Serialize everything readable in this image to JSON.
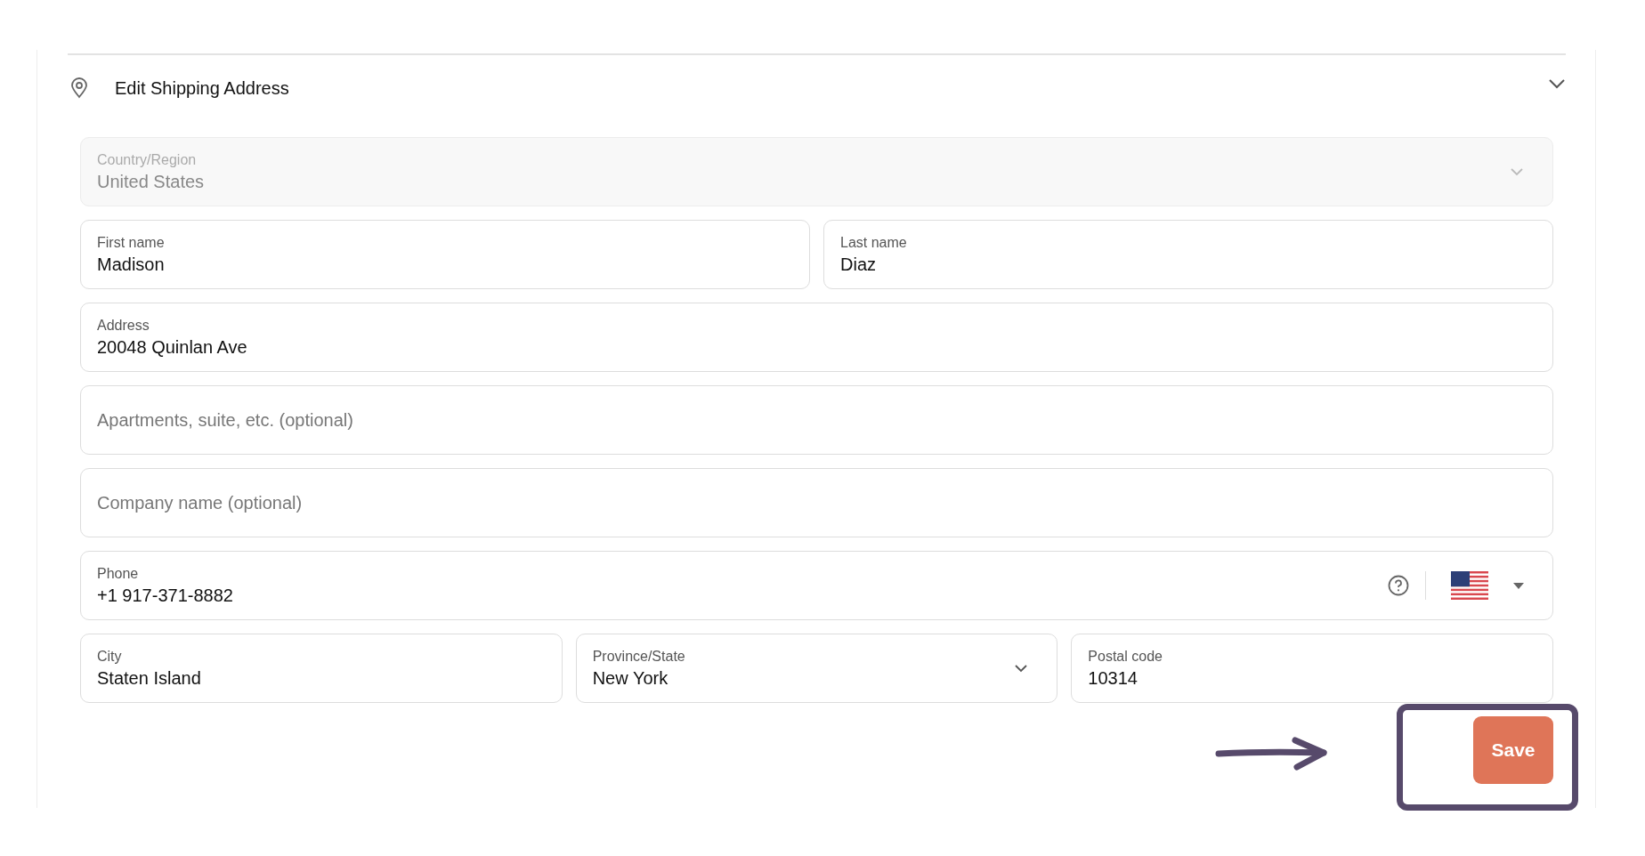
{
  "section": {
    "title": "Edit Shipping Address"
  },
  "rows": [
    [
      {
        "kind": "select",
        "label": "Country/Region",
        "value": "United States",
        "disabled": true
      }
    ],
    [
      {
        "kind": "text",
        "label": "First name",
        "value": "Madison",
        "disabled": false
      },
      {
        "kind": "text",
        "label": "Last name",
        "value": "Diaz",
        "disabled": false
      }
    ],
    [
      {
        "kind": "text",
        "label": "Address",
        "value": "20048 Quinlan Ave",
        "disabled": false
      }
    ],
    [
      {
        "kind": "text",
        "placeholder": "Apartments, suite, etc. (optional)",
        "disabled": false
      }
    ],
    [
      {
        "kind": "text",
        "placeholder": "Company name (optional)",
        "disabled": false
      }
    ],
    [
      {
        "kind": "phone",
        "label": "Phone",
        "value": "+1 917-371-8882",
        "disabled": false
      }
    ],
    [
      {
        "kind": "text",
        "label": "City",
        "value": "Staten Island",
        "disabled": false
      },
      {
        "kind": "select",
        "label": "Province/State",
        "value": "New York",
        "disabled": false
      },
      {
        "kind": "text",
        "label": "Postal code",
        "value": "10314",
        "disabled": false
      }
    ]
  ],
  "save_button": "Save"
}
